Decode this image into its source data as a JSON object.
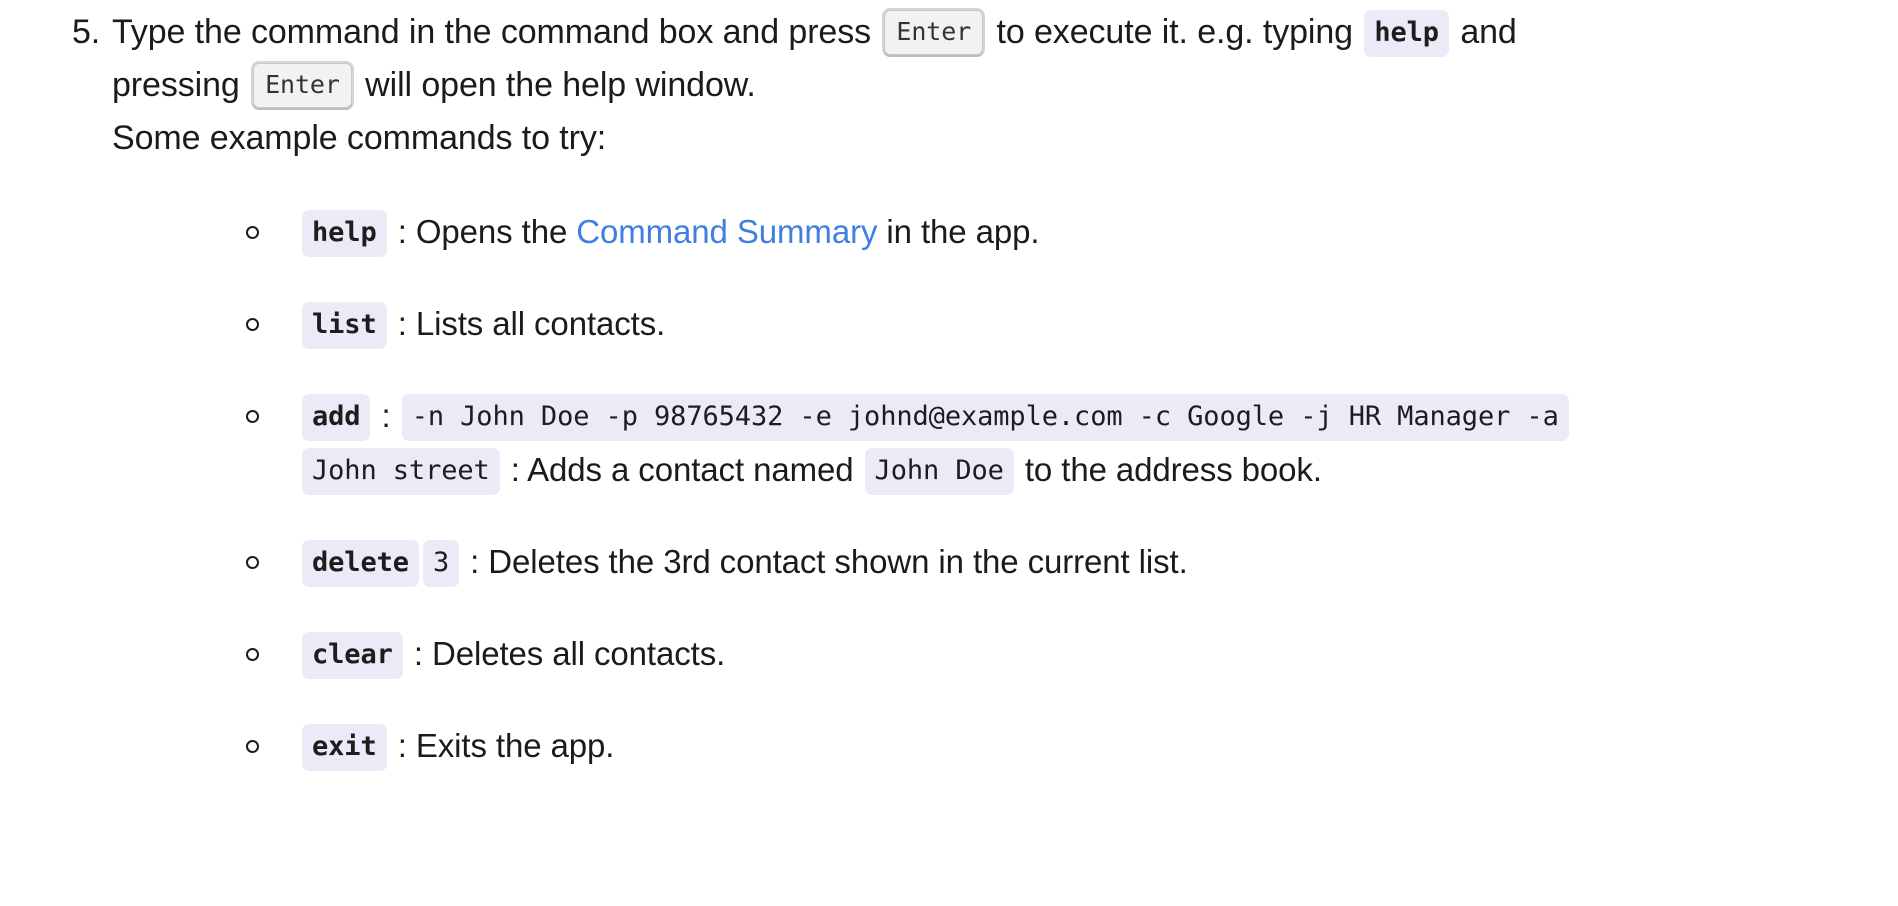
{
  "step": {
    "number": "5.",
    "line1_a": "Type the command in the command box and press ",
    "key_enter_1": "Enter",
    "line1_b": " to execute it. e.g. typing ",
    "code_help_inline": "help",
    "line1_c": " and",
    "line2_a": "pressing ",
    "key_enter_2": "Enter",
    "line2_b": " will open the help window.",
    "line3": "Some example commands to try:"
  },
  "commands": [
    {
      "id": "help",
      "code": "help",
      "sep": " : Opens the ",
      "link": "Command Summary",
      "tail": " in the app."
    },
    {
      "id": "list",
      "code": "list",
      "sep": " : Lists all contacts."
    },
    {
      "id": "add",
      "code": "add",
      "colon": " : ",
      "args_line1": "-n John Doe -p 98765432 -e johnd@example.com -c Google -j HR Manager -a",
      "args_line2": "John street",
      "desc_a": " : Adds a contact named ",
      "name_code": "John Doe",
      "desc_b": " to the address book."
    },
    {
      "id": "delete",
      "code": "delete",
      "arg": "3",
      "sep": " : Deletes the 3rd contact shown in the current list."
    },
    {
      "id": "clear",
      "code": "clear",
      "sep": " : Deletes all contacts."
    },
    {
      "id": "exit",
      "code": "exit",
      "sep": " : Exits the app."
    }
  ],
  "colors": {
    "text": "#1b1b1b",
    "link": "#3f7fe0",
    "code_bg": "#eceaf7",
    "kbd_bg": "#f2f2f2",
    "kbd_border": "#c9c9c9",
    "page_bg": "#ffffff"
  }
}
